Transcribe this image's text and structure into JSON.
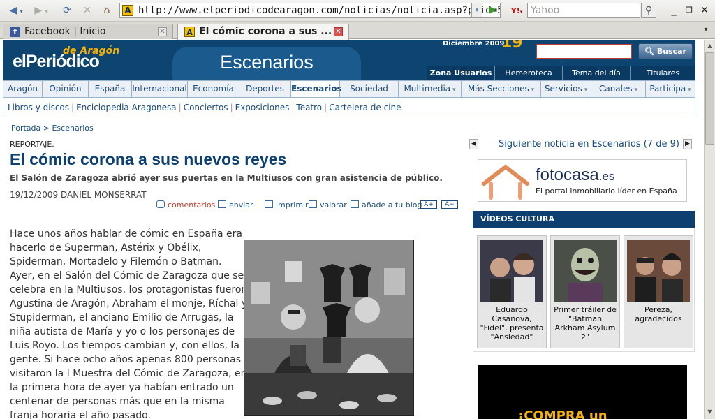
{
  "browser": {
    "url": "http://www.elperiodicodearagon.com/noticias/noticia.asp?pkid=5",
    "search_placeholder": "Yahoo",
    "search_engine_icon": "Y!",
    "tabs": [
      {
        "label": "Facebook | Inicio",
        "icon": "f"
      },
      {
        "label": "El cómic corona a sus ...",
        "icon": "A"
      }
    ]
  },
  "header": {
    "logo_top": "de Aragón",
    "logo_main": "elPeriódico",
    "section": "Escenarios",
    "date_label": "Diciembre 2009",
    "date_day": "19",
    "search_button": "Buscar",
    "user_links": [
      "Zona Usuarios",
      "Hemeroteca",
      "Tema del día",
      "Titulares"
    ]
  },
  "nav": {
    "items": [
      "Aragón",
      "Opinión",
      "España",
      "Internacional",
      "Economía",
      "Deportes",
      "Escenarios",
      "Sociedad",
      "Multimedia",
      "Más Secciones",
      "Servicios",
      "Canales",
      "Participa"
    ],
    "sub": [
      "Libros y discos",
      "Enciclopedia Aragonesa",
      "Conciertos",
      "Exposiciones",
      "Teatro",
      "Cartelera de cine"
    ]
  },
  "article": {
    "breadcrumb": "Portada > Escenarios",
    "kicker": "REPORTAJE.",
    "headline": "El cómic corona a sus nuevos reyes",
    "subtitle": "El Salón de Zaragoza abrió ayer sus puertas en la Multiusos con gran asistencia de público.",
    "byline": "19/12/2009 DANIEL MONSERRAT",
    "tools": {
      "comments": "comentarios",
      "send": "enviar",
      "print": "imprimir",
      "rate": "valorar",
      "blog": "añade a tu blog",
      "font_plus": "A+",
      "font_minus": "A−"
    },
    "body_lines": [
      "Hace unos años hablar de cómic en España era",
      "hacerlo de Superman, Astérix y Obélix,",
      "Spiderman, Mortadelo y Filemón o Batman.",
      "Ayer, en el Salón del Cómic de Zaragoza que se",
      "celebra en la Multiusos, los protagonistas fueron",
      "Agustina de Aragón, Abraham el monje, Ríchal y",
      "Stupiderman, el anciano Emilio de Arrugas, la",
      "niña autista de María y yo o los personajes de",
      "Luis Royo. Los tiempos cambian y, con ellos, la",
      "gente. Si hace ocho años apenas 800 personas",
      "visitaron la I Muestra del Cómic de Zaragoza, en",
      "la primera hora de ayer ya habían entrado un",
      "centenar de personas más que en la misma",
      "franja horaria el año pasado."
    ]
  },
  "sidebar": {
    "next_news": "Siguiente noticia en Escenarios (7 de 9)",
    "ad1_brand": "fotocasa",
    "ad1_tld": ".es",
    "ad1_tagline": "El portal inmobiliario líder en España",
    "videos_title": "VÍDEOS CULTURA",
    "videos": [
      {
        "caption": "Eduardo Casanova, \"Fidel\", presenta \"Ansiedad\""
      },
      {
        "caption": "Primer tráiler de \"Batman Arkham Asylum 2\""
      },
      {
        "caption": "Pereza, agradecidos"
      }
    ],
    "ad2_text": "¡COMPRA un"
  }
}
